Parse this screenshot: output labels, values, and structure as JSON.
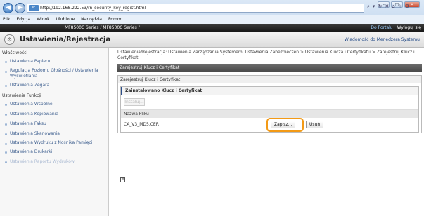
{
  "browser": {
    "url": "http://192.168.222.53/rn_security_key_regist.html",
    "search_placeholder": "",
    "menu": [
      "Plik",
      "Edycja",
      "Widok",
      "Ulubione",
      "Narzędzia",
      "Pomoc"
    ]
  },
  "device_bar": {
    "model": "MF8500C Series / MF8500C Series /",
    "portal_link": "Do Portalu",
    "logout_link": "Wyloguj się"
  },
  "header": {
    "title": "Ustawienia/Rejestracja",
    "mail_link": "Wiadomość do Menedżera Systemu"
  },
  "sidebar": {
    "section1": "Właściwości",
    "items1": [
      "Ustawienia Papieru",
      "Regulacja Poziomu Głośności / Ustawienia Wyświetlania",
      "Ustawienia Zegara"
    ],
    "section2": "Ustawienia Funkcji",
    "items2": [
      "Ustawienia Wspólne",
      "Ustawienia Kopiowania",
      "Ustawienia Faksu",
      "Ustawienia Skanowania",
      "Ustawienia Wydruku z Nośnika Pamięci",
      "Ustawienia Drukarki",
      "Ustawienia Raportu Wydruków"
    ]
  },
  "main": {
    "breadcrumb": "Ustawienia/Rejestracja: Ustawienia Zarządzania Systemem: Ustawienia Zabezpieczeń > Ustawienia Klucza i Certyfikatu > Zarejestruj Klucz i Certyfikat",
    "section_bar": "Zarejestruj Klucz i Certyfikat",
    "panel_header": "Zarejestruj Klucz i Certyfikat",
    "subsection": "Zainstalowano Klucz i Certyfikat",
    "install_button": "Instaluj...",
    "file_column_header": "Nazwa Pliku",
    "file_name": "CA_V3_MD5.CER",
    "register_button": "Zapisz...",
    "delete_button": "Usuń"
  },
  "colors": {
    "highlight": "#f39a16",
    "device_bar": "#1e1e1e",
    "link": "#3e5f8f"
  }
}
